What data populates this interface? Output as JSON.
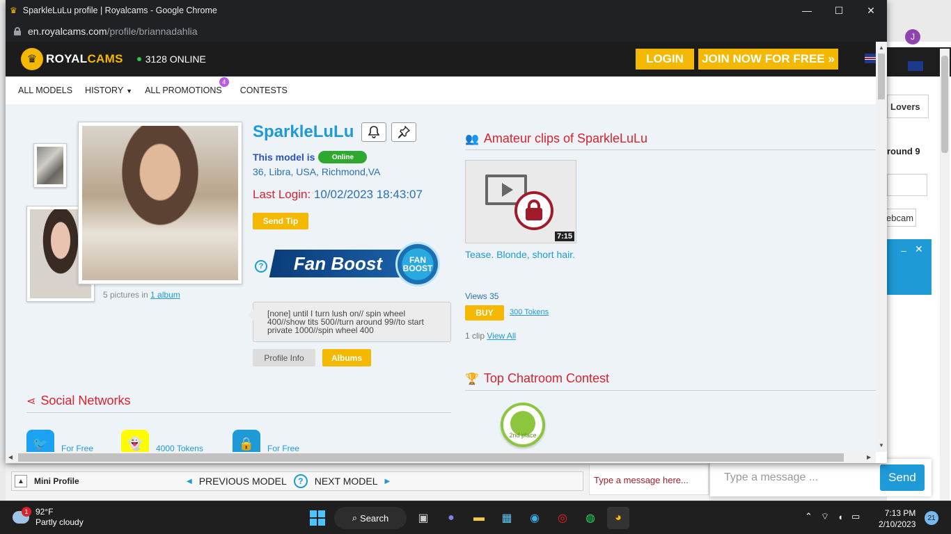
{
  "window": {
    "title": "SparkleLuLu profile | Royalcams - Google Chrome",
    "url_host": "en.royalcams.com",
    "url_path": "/profile/briannadahlia"
  },
  "site": {
    "logo_royal": "ROYAL",
    "logo_cams": "CAMS",
    "online_count": "3128 ONLINE",
    "login_label": "LOGIN",
    "join_label": "JOIN NOW FOR FREE »",
    "accent": "#f5b800",
    "link_blue": "#1e9ad6",
    "title_red": "#d8222d"
  },
  "nav": {
    "all_models": "ALL MODELS",
    "history": "HISTORY",
    "all_promotions": "ALL PROMOTIONS",
    "promotions_badge": "4",
    "contests": "CONTESTS"
  },
  "profile": {
    "name": "SparkleLuLu",
    "status_prefix": "This model is",
    "status": "Online",
    "details": "36, Libra, USA, Richmond,VA",
    "last_login_label": "Last Login:",
    "last_login_value": "10/02/2023 18:43:07",
    "send_tip": "Send Tip",
    "fanboost": "Fan Boost",
    "fanboost_badge_line1": "FAN",
    "fanboost_badge_line2": "BOOST",
    "tip_menu": "[none] until I turn lush on// spin wheel 400//show tits 500//turn around 99//to start private 1000//spin wheel 400",
    "profile_info": "Profile Info",
    "albums": "Albums",
    "pictures_prefix": "5 pictures in",
    "pictures_album": "1 album"
  },
  "social": {
    "title": "Social Networks",
    "items": [
      {
        "icon": "twitter-icon",
        "label": "For Free"
      },
      {
        "icon": "snapchat-icon",
        "label": "4000 Tokens"
      },
      {
        "icon": "lock-icon",
        "label": "For Free"
      }
    ]
  },
  "clips": {
    "title": "Amateur clips of SparkleLuLu",
    "duration": "7:15",
    "clip_title": "Tease. Blonde, short hair.",
    "views": "Views 35",
    "buy": "BUY",
    "price": "300 Tokens",
    "count_prefix": "1 clip",
    "view_all": "View All"
  },
  "contest": {
    "title": "Top Chatroom Contest",
    "badge": "2nd place"
  },
  "background": {
    "lovers": "Lovers",
    "round": "round 9",
    "webcam": "ebcam",
    "mini_profile": "Mini Profile",
    "previous_model": "PREVIOUS MODEL",
    "next_model": "NEXT MODEL",
    "message_placeholder": "Type a message here...",
    "chat_placeholder": "Type a message ...",
    "send": "Send",
    "avatar_letter": "J"
  },
  "taskbar": {
    "weather_badge": "1",
    "temp": "92°F",
    "condition": "Partly cloudy",
    "search": "Search",
    "time": "7:13 PM",
    "date": "2/10/2023",
    "notifications": "21"
  }
}
